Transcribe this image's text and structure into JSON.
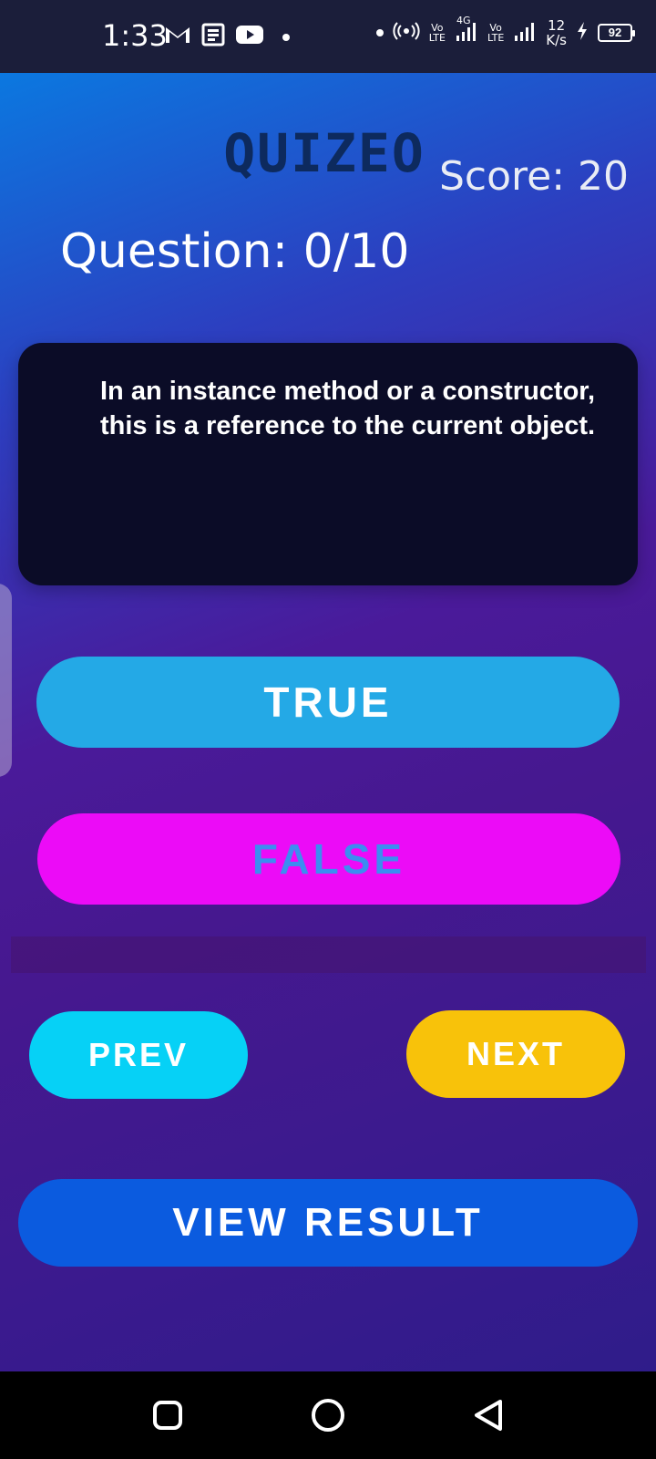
{
  "status_bar": {
    "time": "1:33",
    "network_speed_value": "12",
    "network_speed_unit": "K/s",
    "sim1_label_top": "Vo",
    "sim1_label_bottom": "LTE",
    "sim1_type": "4G",
    "sim2_label_top": "Vo",
    "sim2_label_bottom": "LTE",
    "battery_level": "92",
    "icons": [
      "gmail-icon",
      "news-icon",
      "youtube-icon",
      "hotspot-icon",
      "signal-icon",
      "charging-icon",
      "battery-icon"
    ]
  },
  "header": {
    "logo_text": "QUIZEO",
    "score_label": "Score: 20",
    "question_counter": "Question: 0/10"
  },
  "question": {
    "text": "In an instance method or a constructor, this is a reference to the current object."
  },
  "answers": {
    "true_label": "TRUE",
    "false_label": "FALSE"
  },
  "navigation": {
    "prev_label": "PREV",
    "next_label": "NEXT",
    "view_result_label": "VIEW RESULT"
  },
  "system_nav": {
    "icons": [
      "recents-icon",
      "home-icon",
      "back-icon"
    ]
  },
  "colors": {
    "true_button": "#24a9e6",
    "false_button": "#ec0bf7",
    "false_text": "#3c8df0",
    "prev_button": "#06d1f6",
    "next_button": "#f8c20a",
    "result_button": "#0b5bdf",
    "question_card": "#0b0c27",
    "logo": "#0d2a5e"
  }
}
